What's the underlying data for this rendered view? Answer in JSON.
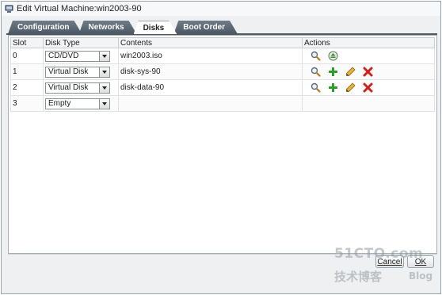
{
  "window": {
    "title": "Edit Virtual Machine:win2003-90",
    "icon": "vm-icon"
  },
  "tabs": [
    {
      "label": "Configuration",
      "active": false
    },
    {
      "label": "Networks",
      "active": false
    },
    {
      "label": "Disks",
      "active": true
    },
    {
      "label": "Boot Order",
      "active": false
    }
  ],
  "table": {
    "headers": {
      "slot": "Slot",
      "disk_type": "Disk Type",
      "contents": "Contents",
      "actions": "Actions"
    },
    "rows": [
      {
        "slot": "0",
        "disk_type": "CD/DVD",
        "contents": "win2003.iso",
        "actions": [
          "search-icon",
          "eject-icon"
        ]
      },
      {
        "slot": "1",
        "disk_type": "Virtual Disk",
        "contents": "disk-sys-90",
        "actions": [
          "search-icon",
          "add-icon",
          "edit-icon",
          "delete-icon"
        ]
      },
      {
        "slot": "2",
        "disk_type": "Virtual Disk",
        "contents": "disk-data-90",
        "actions": [
          "search-icon",
          "add-icon",
          "edit-icon",
          "delete-icon"
        ]
      },
      {
        "slot": "3",
        "disk_type": "Empty",
        "contents": "",
        "actions": []
      }
    ]
  },
  "buttons": {
    "cancel": "Cancel",
    "ok": "OK"
  },
  "watermark": {
    "line1": "51CTO.com",
    "line2": "技术博客",
    "blog": "Blog"
  },
  "colors": {
    "tab_bg": "#4b5762",
    "delete": "#d0201a",
    "add": "#2e9e2a",
    "edit": "#d9a21b"
  }
}
